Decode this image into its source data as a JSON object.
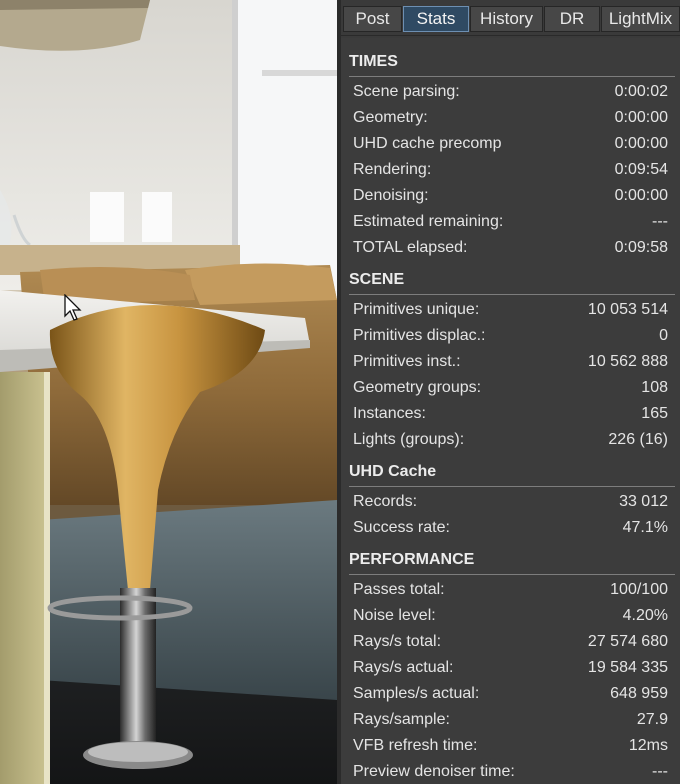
{
  "tabs": [
    {
      "label": "Post",
      "active": false
    },
    {
      "label": "Stats",
      "active": true
    },
    {
      "label": "History",
      "active": false
    },
    {
      "label": "DR",
      "active": false
    },
    {
      "label": "LightMix",
      "active": false
    }
  ],
  "sections": [
    {
      "title": "TIMES",
      "rows": [
        {
          "label": "Scene parsing:",
          "value": "0:00:02"
        },
        {
          "label": "Geometry:",
          "value": "0:00:00"
        },
        {
          "label": "UHD cache precomp",
          "value": "0:00:00"
        },
        {
          "label": "Rendering:",
          "value": "0:09:54"
        },
        {
          "label": "Denoising:",
          "value": "0:00:00"
        },
        {
          "label": "Estimated remaining:",
          "value": "---"
        },
        {
          "label": "TOTAL elapsed:",
          "value": "0:09:58"
        }
      ]
    },
    {
      "title": "SCENE",
      "rows": [
        {
          "label": "Primitives unique:",
          "value": "10 053 514"
        },
        {
          "label": "Primitives displac.:",
          "value": "0"
        },
        {
          "label": "Primitives inst.:",
          "value": "10 562 888"
        },
        {
          "label": "Geometry groups:",
          "value": "108"
        },
        {
          "label": "Instances:",
          "value": "165"
        },
        {
          "label": "Lights (groups):",
          "value": "226 (16)"
        }
      ]
    },
    {
      "title": "UHD Cache",
      "rows": [
        {
          "label": "Records:",
          "value": "33 012"
        },
        {
          "label": "Success rate:",
          "value": "47.1%"
        }
      ]
    },
    {
      "title": "PERFORMANCE",
      "rows": [
        {
          "label": "Passes total:",
          "value": "100/100"
        },
        {
          "label": "Noise level:",
          "value": "4.20%"
        },
        {
          "label": "Rays/s total:",
          "value": "27 574 680"
        },
        {
          "label": "Rays/s actual:",
          "value": "19 584 335"
        },
        {
          "label": "Samples/s actual:",
          "value": "648 959"
        },
        {
          "label": "Rays/sample:",
          "value": "27.9"
        },
        {
          "label": "VFB refresh time:",
          "value": "12ms"
        },
        {
          "label": "Preview denoiser time:",
          "value": "---"
        }
      ]
    }
  ],
  "icons": {
    "cursor": "mouse-pointer-icon"
  }
}
